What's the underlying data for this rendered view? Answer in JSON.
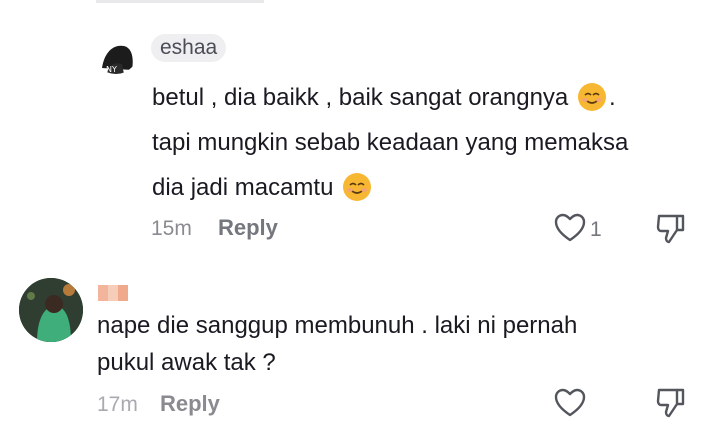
{
  "comments": [
    {
      "username": "eshaa",
      "lines": [
        "betul , dia baikk , baik sangat orangnya",
        "tapi mungkin sebab keadaan yang memaksa",
        "dia jadi macamtu"
      ],
      "time": "15m",
      "reply_label": "Reply",
      "likes": "1"
    },
    {
      "lines": [
        "nape die sanggup membunuh . laki ni pernah",
        "pukul awak tak ?"
      ],
      "time": "17m",
      "reply_label": "Reply"
    }
  ],
  "colors": {
    "text": "#1a1b22",
    "meta": "#8a8b91",
    "pill": "#efeff1",
    "emoji": "#f7b733"
  },
  "icons": [
    "avatar",
    "smiling-face-emoji",
    "heart-icon",
    "dislike-icon"
  ]
}
